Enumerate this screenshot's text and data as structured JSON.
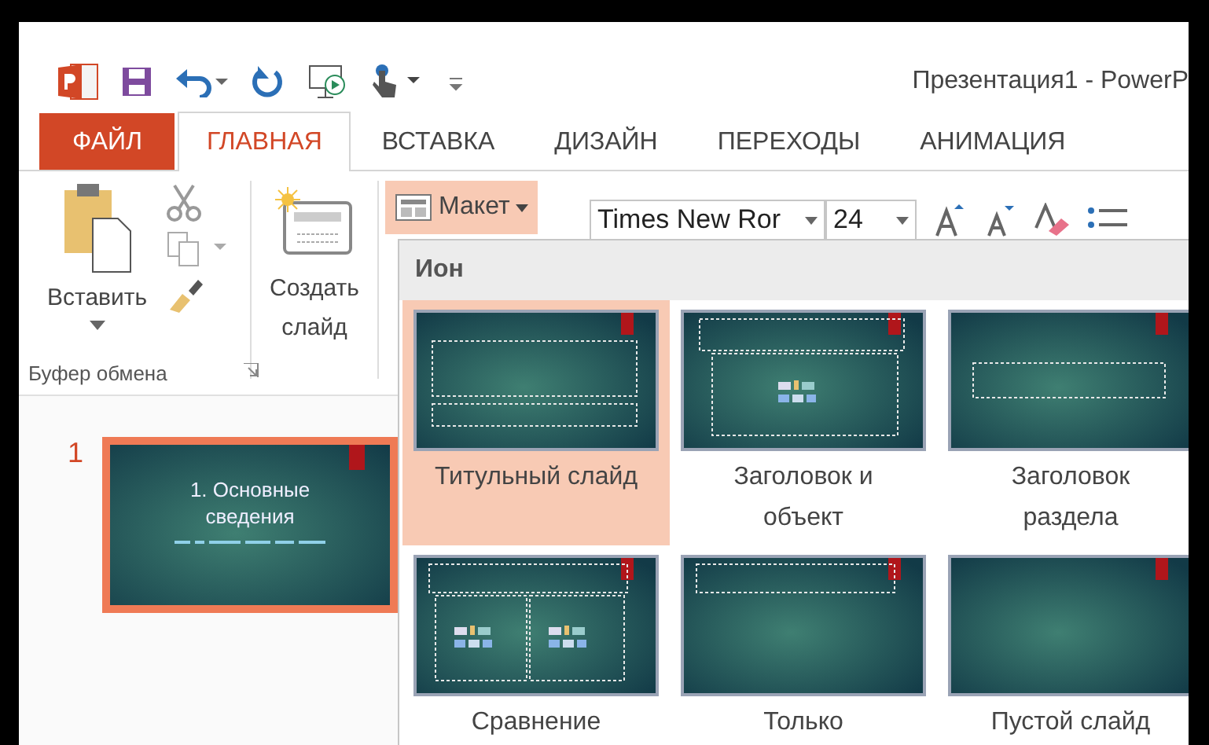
{
  "window": {
    "title": "Презентация1 - PowerP"
  },
  "tabs": [
    {
      "label": "ФАЙЛ",
      "kind": "file",
      "selected": false
    },
    {
      "label": "ГЛАВНАЯ",
      "kind": "tab",
      "selected": true
    },
    {
      "label": "ВСТАВКА",
      "kind": "tab",
      "selected": false
    },
    {
      "label": "ДИЗАЙН",
      "kind": "tab",
      "selected": false
    },
    {
      "label": "ПЕРЕХОДЫ",
      "kind": "tab",
      "selected": false
    },
    {
      "label": "АНИМАЦИЯ",
      "kind": "tab",
      "selected": false
    }
  ],
  "ribbon": {
    "paste": "Вставить",
    "new_slide": "Создать слайд",
    "layout_button": {
      "label": "Макет",
      "expanded": true
    },
    "font_name": "Times New Ror",
    "font_size": "24",
    "clipboard_group": "Буфер обмена"
  },
  "layout_menu": {
    "title": "Ион",
    "layouts": [
      {
        "label": "Титульный слайд",
        "kind": "title",
        "selected": true
      },
      {
        "label": "Заголовок и объект",
        "kind": "title_content",
        "selected": false
      },
      {
        "label": "Заголовок раздела",
        "kind": "section",
        "selected": false
      },
      {
        "label": "Сравнение",
        "kind": "comparison",
        "selected": false
      },
      {
        "label": "Только",
        "kind": "title_only",
        "selected": false
      },
      {
        "label": "Пустой слайд",
        "kind": "blank",
        "selected": false
      }
    ]
  },
  "slides": [
    {
      "number": "1",
      "title": "1. Основные сведения",
      "selected": true
    }
  ]
}
